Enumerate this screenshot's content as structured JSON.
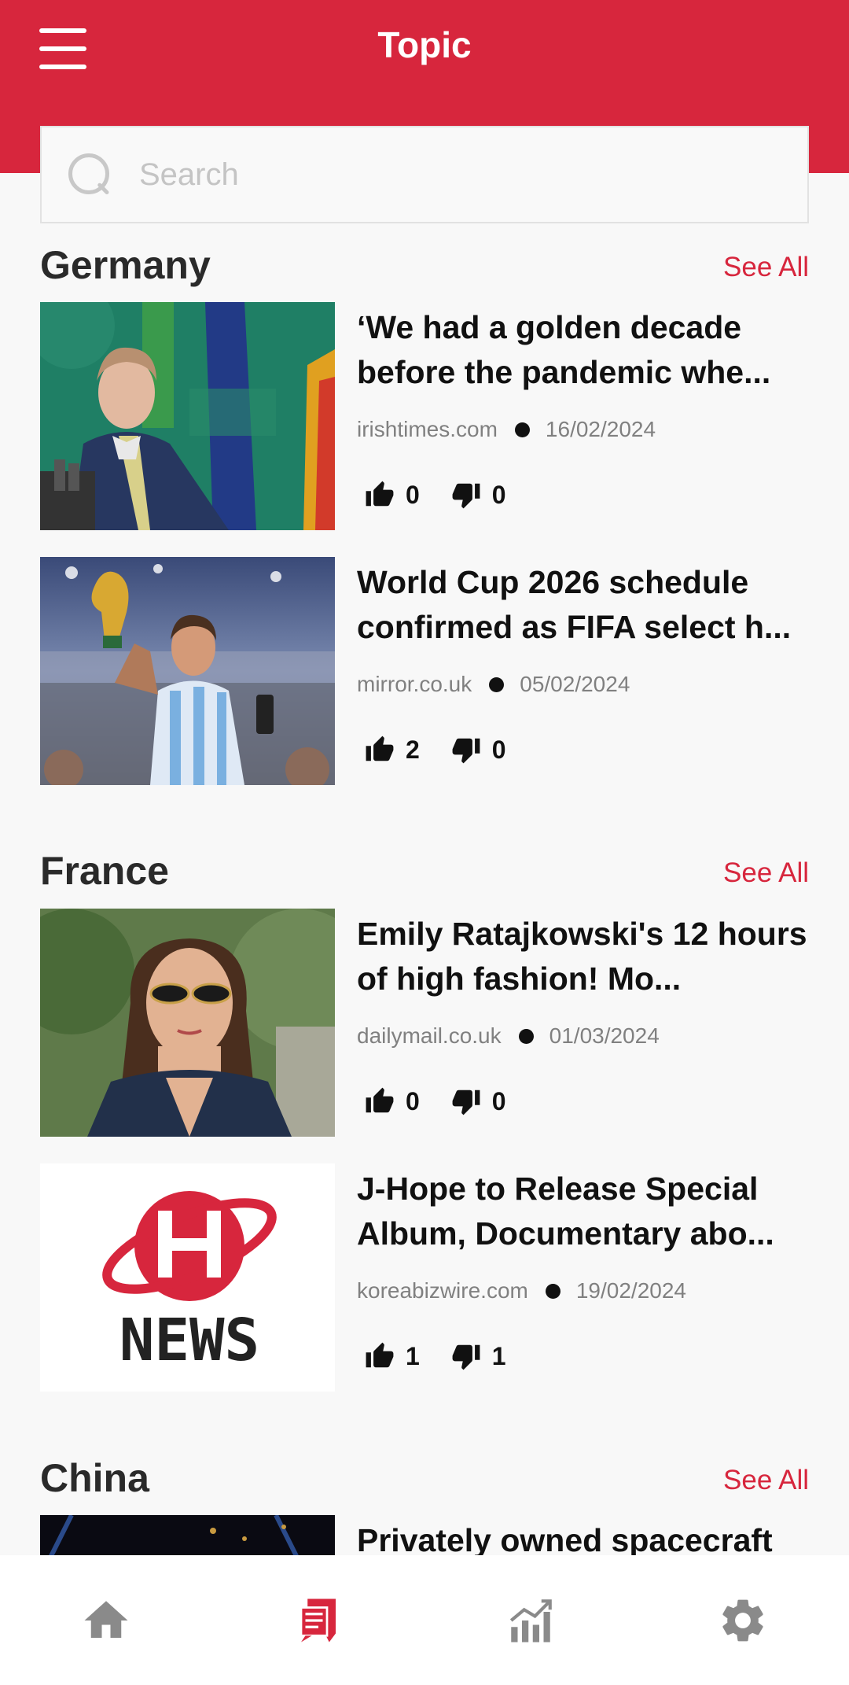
{
  "header": {
    "title": "Topic"
  },
  "search": {
    "placeholder": "Search",
    "value": ""
  },
  "sections": [
    {
      "title": "Germany",
      "see_all": "See All",
      "articles": [
        {
          "title": "‘We had a golden decade before the pandemic whe...",
          "source": "irishtimes.com",
          "date": "16/02/2024",
          "likes": "0",
          "dislikes": "0",
          "image": "politician-speaking-photo"
        },
        {
          "title": "World Cup 2026 schedule confirmed as FIFA select h...",
          "source": "mirror.co.uk",
          "date": "05/02/2024",
          "likes": "2",
          "dislikes": "0",
          "image": "player-holding-trophy-photo"
        }
      ]
    },
    {
      "title": "France",
      "see_all": "See All",
      "articles": [
        {
          "title": "Emily Ratajkowski's 12 hours of high fashion! Mo...",
          "source": "dailymail.co.uk",
          "date": "01/03/2024",
          "likes": "0",
          "dislikes": "0",
          "image": "woman-sunglasses-photo"
        },
        {
          "title": "J-Hope to Release Special Album, Documentary abo...",
          "source": "koreabizwire.com",
          "date": "19/02/2024",
          "likes": "1",
          "dislikes": "1",
          "image": "news-logo",
          "logo_text": "NEWS"
        }
      ]
    },
    {
      "title": "China",
      "see_all": "See All",
      "articles": [
        {
          "title": "Privately owned spacecraft",
          "image": "night-launch-photo"
        }
      ]
    }
  ],
  "bottom_nav": [
    {
      "icon": "home-icon",
      "active": false
    },
    {
      "icon": "news-icon",
      "active": true
    },
    {
      "icon": "chart-icon",
      "active": false
    },
    {
      "icon": "gear-icon",
      "active": false
    }
  ],
  "colors": {
    "accent": "#d7263d",
    "inactive": "#8a8a8a"
  }
}
